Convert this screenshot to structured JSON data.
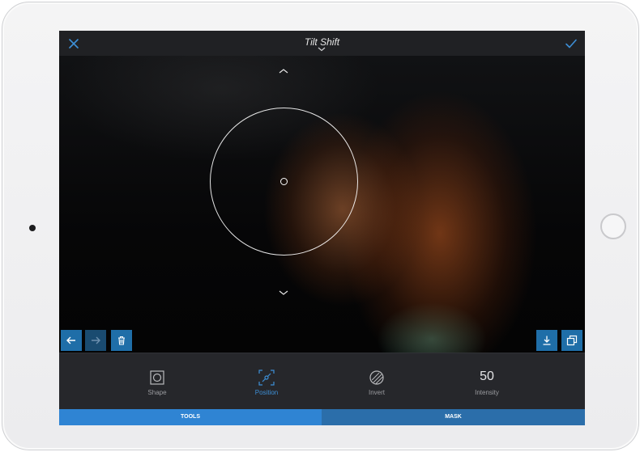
{
  "app": {
    "title": "Tilt Shift"
  },
  "toolbar": {
    "tools": [
      {
        "label": "Shape",
        "icon": "square-shape-icon"
      },
      {
        "label": "Position",
        "icon": "position-icon",
        "active": true
      },
      {
        "label": "Invert",
        "icon": "invert-icon"
      },
      {
        "label": "Intensity",
        "value": "50"
      }
    ]
  },
  "tabs": [
    {
      "label": "TOOLS",
      "active": true
    },
    {
      "label": "MASK"
    }
  ],
  "icons": {
    "close": "close-icon",
    "confirm": "checkmark-icon",
    "undo": "arrow-left-icon",
    "redo": "arrow-right-icon",
    "delete": "trash-icon",
    "download": "download-icon",
    "compare": "copy-icon"
  },
  "colors": {
    "accent": "#2f84d3",
    "accent_dark": "#2b6eaa",
    "active_label": "#3d8fd6",
    "background": "#1f2023"
  }
}
